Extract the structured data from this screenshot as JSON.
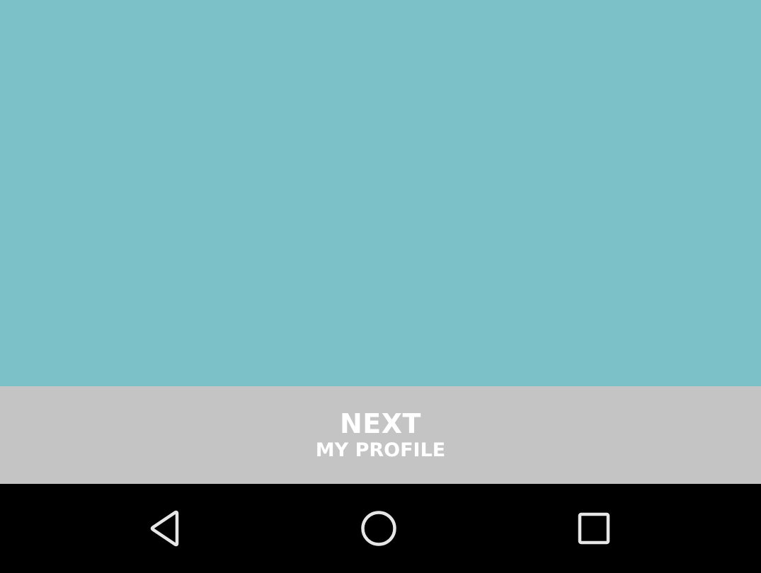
{
  "next_button": {
    "title": "NEXT",
    "subtitle": "MY PROFILE"
  },
  "navigation": {
    "back_icon": "back-triangle-icon",
    "home_icon": "home-circle-icon",
    "recents_icon": "recents-square-icon"
  },
  "colors": {
    "content_background": "#7dc1c8",
    "next_bar_background": "#c4c4c4",
    "nav_bar_background": "#000000",
    "nav_icon": "#e6e6e6",
    "text": "#ffffff"
  }
}
